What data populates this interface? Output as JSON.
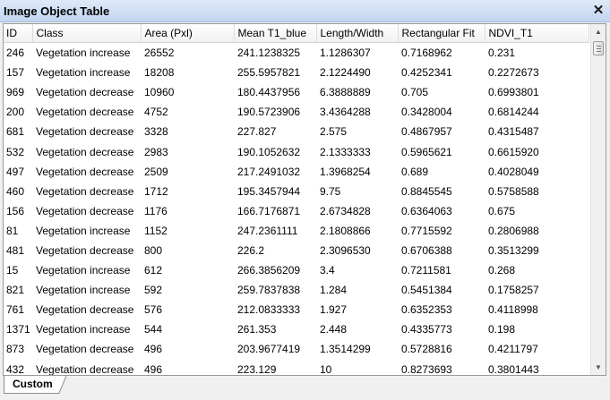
{
  "window": {
    "title": "Image Object Table",
    "close_glyph": "✕"
  },
  "columns": [
    "ID",
    "Class",
    "Area (Pxl)",
    "Mean T1_blue",
    "Length/Width",
    "Rectangular Fit",
    "NDVI_T1"
  ],
  "rows": [
    [
      "246",
      "Vegetation increase",
      "26552",
      "241.1238325",
      "1.1286307",
      "0.7168962",
      "0.231"
    ],
    [
      "157",
      "Vegetation increase",
      "18208",
      "255.5957821",
      "2.1224490",
      "0.4252341",
      "0.2272673"
    ],
    [
      "969",
      "Vegetation decrease",
      "10960",
      "180.4437956",
      "6.3888889",
      "0.705",
      "0.6993801"
    ],
    [
      "200",
      "Vegetation decrease",
      "4752",
      "190.5723906",
      "3.4364288",
      "0.3428004",
      "0.6814244"
    ],
    [
      "681",
      "Vegetation decrease",
      "3328",
      "227.827",
      "2.575",
      "0.4867957",
      "0.4315487"
    ],
    [
      "532",
      "Vegetation decrease",
      "2983",
      "190.1052632",
      "2.1333333",
      "0.5965621",
      "0.6615920"
    ],
    [
      "497",
      "Vegetation decrease",
      "2509",
      "217.2491032",
      "1.3968254",
      "0.689",
      "0.4028049"
    ],
    [
      "460",
      "Vegetation decrease",
      "1712",
      "195.3457944",
      "9.75",
      "0.8845545",
      "0.5758588"
    ],
    [
      "156",
      "Vegetation decrease",
      "1176",
      "166.7176871",
      "2.6734828",
      "0.6364063",
      "0.675"
    ],
    [
      "81",
      "Vegetation increase",
      "1152",
      "247.2361111",
      "2.1808866",
      "0.7715592",
      "0.2806988"
    ],
    [
      "481",
      "Vegetation decrease",
      "800",
      "226.2",
      "2.3096530",
      "0.6706388",
      "0.3513299"
    ],
    [
      "15",
      "Vegetation increase",
      "612",
      "266.3856209",
      "3.4",
      "0.7211581",
      "0.268"
    ],
    [
      "821",
      "Vegetation increase",
      "592",
      "259.7837838",
      "1.284",
      "0.5451384",
      "0.1758257"
    ],
    [
      "761",
      "Vegetation decrease",
      "576",
      "212.0833333",
      "1.927",
      "0.6352353",
      "0.4118998"
    ],
    [
      "1371",
      "Vegetation increase",
      "544",
      "261.353",
      "2.448",
      "0.4335773",
      "0.198"
    ],
    [
      "873",
      "Vegetation decrease",
      "496",
      "203.9677419",
      "1.3514299",
      "0.5728816",
      "0.4211797"
    ],
    [
      "432",
      "Vegetation decrease",
      "496",
      "223.129",
      "10",
      "0.8273693",
      "0.3801443"
    ]
  ],
  "scrollbar": {
    "up_glyph": "▲",
    "down_glyph": "▼"
  },
  "tabs": [
    {
      "label": "Custom"
    }
  ],
  "colors": {
    "titlebar": "#c3d6ef",
    "table_bg": "#ffffff"
  }
}
